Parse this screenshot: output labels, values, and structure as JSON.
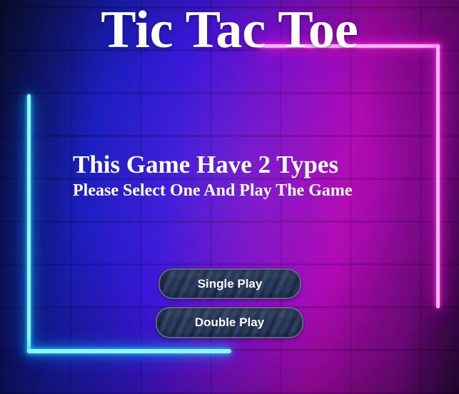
{
  "game": {
    "title": "Tic Tac Toe"
  },
  "info": {
    "line1": "This Game Have 2 Types",
    "line2": "Please Select One And Play The Game"
  },
  "buttons": {
    "single_label": "Single Play",
    "double_label": "Double Play"
  },
  "colors": {
    "neon_cyan": "#8ef6ff",
    "neon_pink": "#ffb3f7",
    "background_left": "#1b1fc0",
    "background_right": "#b00ab4"
  }
}
